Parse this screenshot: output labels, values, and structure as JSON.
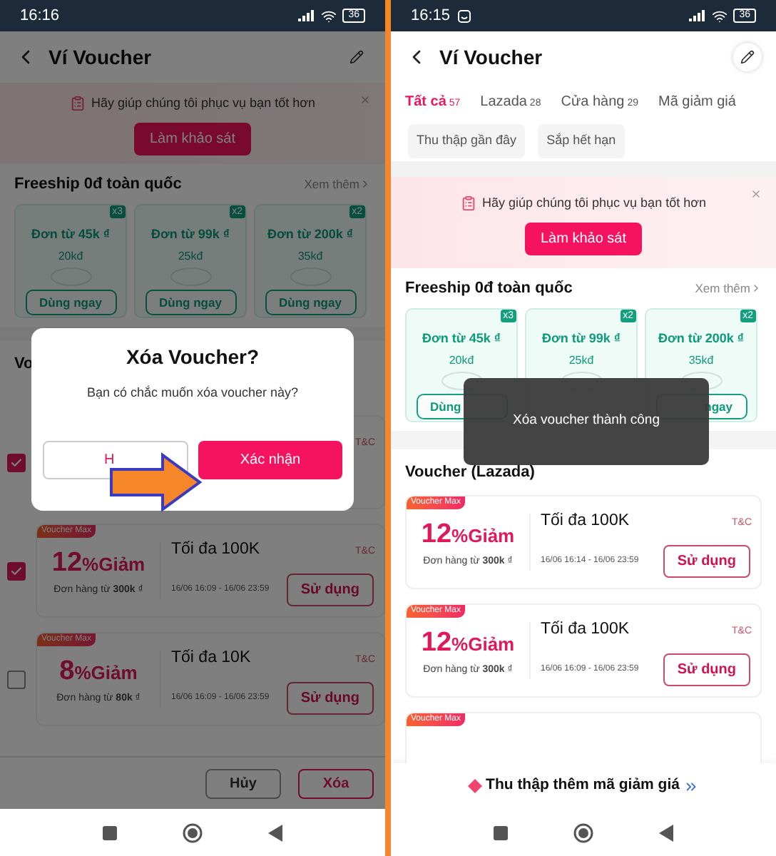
{
  "left_screen": {
    "status_bar": {
      "time": "16:16",
      "battery": "36"
    },
    "header": {
      "title": "Ví Voucher"
    },
    "survey_banner": {
      "message": "Hãy giúp chúng tôi phục vụ bạn tốt hơn",
      "button": "Làm khảo sát"
    },
    "freeship": {
      "title": "Freeship 0đ toàn quốc",
      "see_more": "Xem thêm",
      "cards": [
        {
          "count": "x3",
          "min_order": "Đơn từ 45k ₫",
          "discount": "20kđ",
          "button": "Dùng ngay"
        },
        {
          "count": "x2",
          "min_order": "Đơn từ 99k ₫",
          "discount": "25kđ",
          "button": "Dùng ngay"
        },
        {
          "count": "x2",
          "min_order": "Đơn từ 200k ₫",
          "discount": "35kđ",
          "button": "Dùng ngay"
        }
      ]
    },
    "section_title": "Vo",
    "vouchers": [
      {
        "checked": true,
        "tc": "T&C"
      },
      {
        "checked": true,
        "badge": "Voucher Max",
        "percent": "12",
        "percent_suffix": "%Giảm",
        "min_order": "Đơn hàng từ **300k** ₫",
        "max": "Tối đa 100K",
        "validity": "16/06 16:09 - 16/06 23:59",
        "action": "Sử dụng",
        "tc": "T&C"
      },
      {
        "checked": false,
        "badge": "Voucher Max",
        "percent": "8",
        "percent_suffix": "%Giảm",
        "min_order": "Đơn hàng từ **80k** ₫",
        "max": "Tối đa 10K",
        "validity": "16/06 16:09 - 16/06 23:59",
        "action": "Sử dụng",
        "tc": "T&C"
      }
    ],
    "bottom_actions": [
      {
        "label": "Hủy",
        "kind": "secondary"
      },
      {
        "label": "Xóa",
        "kind": "danger"
      }
    ],
    "dialog": {
      "title": "Xóa Voucher?",
      "message": "Bạn có chắc muốn xóa voucher này?",
      "cancel": "H",
      "confirm": "Xác nhận"
    }
  },
  "right_screen": {
    "status_bar": {
      "time": "16:15",
      "battery": "36"
    },
    "header": {
      "title": "Ví Voucher"
    },
    "tabs": [
      {
        "label": "Tất cả",
        "count": "57",
        "selected": true
      },
      {
        "label": "Lazada",
        "count": "28",
        "selected": false
      },
      {
        "label": "Cửa hàng",
        "count": "29",
        "selected": false
      },
      {
        "label": "Mã giảm giá",
        "selected": false
      }
    ],
    "filters": [
      "Thu thập gần đây",
      "Sắp hết hạn"
    ],
    "survey_banner": {
      "message": "Hãy giúp chúng tôi phục vụ bạn tốt hơn",
      "button": "Làm khảo sát"
    },
    "freeship": {
      "title": "Freeship 0đ toàn quốc",
      "see_more": "Xem thêm",
      "cards": [
        {
          "kind": "leading",
          "count": "x3",
          "min_order": "Đơn từ 45k ₫",
          "discount": "20kđ",
          "button": "Dùng"
        },
        {
          "count": "x2",
          "min_order": "Đơn từ 99k ₫",
          "discount": "25kđ"
        },
        {
          "kind": "trailing",
          "count": "x2",
          "min_order": "Đơn từ 200k ₫",
          "discount": "35kđ",
          "button": "ngay"
        }
      ]
    },
    "section_title": "Voucher (Lazada)",
    "vouchers": [
      {
        "badge": "Voucher Max",
        "percent": "12",
        "percent_suffix": "%Giảm",
        "min_order": "Đơn hàng từ **300k** ₫",
        "max": "Tối đa 100K",
        "validity": "16/06 16:14 - 16/06 23:59",
        "action": "Sử dụng",
        "tc": "T&C"
      },
      {
        "badge": "Voucher Max",
        "percent": "12",
        "percent_suffix": "%Giảm",
        "min_order": "Đơn hàng từ **300k** ₫",
        "max": "Tối đa 100K",
        "validity": "16/06 16:09 - 16/06 23:59",
        "action": "Sử dụng",
        "tc": "T&C"
      },
      {
        "badge": "Voucher Max"
      }
    ],
    "toast": "Xóa voucher thành công",
    "collect_more": "Thu thập thêm mã giảm giá"
  }
}
